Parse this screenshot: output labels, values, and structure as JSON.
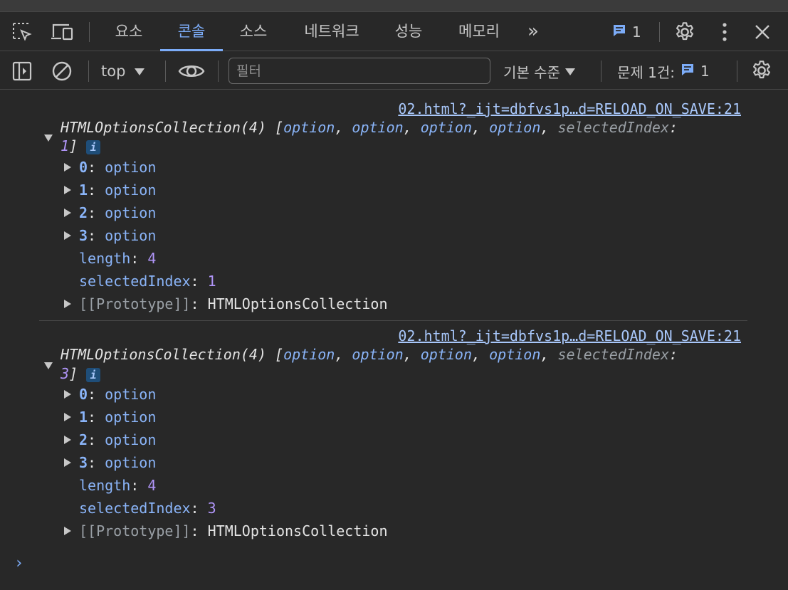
{
  "tabs": [
    {
      "label": "요소",
      "active": false
    },
    {
      "label": "콘솔",
      "active": true
    },
    {
      "label": "소스",
      "active": false
    },
    {
      "label": "네트워크",
      "active": false
    },
    {
      "label": "성능",
      "active": false
    },
    {
      "label": "메모리",
      "active": false
    }
  ],
  "header": {
    "more_tabs_glyph": "»",
    "issue_count": "1"
  },
  "toolbar": {
    "context": "top",
    "filter_placeholder": "필터",
    "levels_label": "기본 수준",
    "issues_label": "문제 1건:",
    "issues_count": "1"
  },
  "console": {
    "entries": [
      {
        "source": "02.html?_ijt=dbfvs1p…d=RELOAD_ON_SAVE:21",
        "summary_head": "HTMLOptionsCollection(4) ",
        "summary_open": "[",
        "summary_items": [
          "option",
          "option",
          "option",
          "option"
        ],
        "summary_sel_key": "selectedIndex",
        "summary_sel_val": "1",
        "summary_close": "]",
        "items": [
          {
            "key": "0",
            "value": "option"
          },
          {
            "key": "1",
            "value": "option"
          },
          {
            "key": "2",
            "value": "option"
          },
          {
            "key": "3",
            "value": "option"
          }
        ],
        "length_key": "length",
        "length_val": "4",
        "sel_key": "selectedIndex",
        "sel_val": "1",
        "proto_key": "[[Prototype]]",
        "proto_val": "HTMLOptionsCollection"
      },
      {
        "source": "02.html?_ijt=dbfvs1p…d=RELOAD_ON_SAVE:21",
        "summary_head": "HTMLOptionsCollection(4) ",
        "summary_open": "[",
        "summary_items": [
          "option",
          "option",
          "option",
          "option"
        ],
        "summary_sel_key": "selectedIndex",
        "summary_sel_val": "3",
        "summary_close": "]",
        "items": [
          {
            "key": "0",
            "value": "option"
          },
          {
            "key": "1",
            "value": "option"
          },
          {
            "key": "2",
            "value": "option"
          },
          {
            "key": "3",
            "value": "option"
          }
        ],
        "length_key": "length",
        "length_val": "4",
        "sel_key": "selectedIndex",
        "sel_val": "3",
        "proto_key": "[[Prototype]]",
        "proto_val": "HTMLOptionsCollection"
      }
    ],
    "prompt_glyph": "›"
  }
}
